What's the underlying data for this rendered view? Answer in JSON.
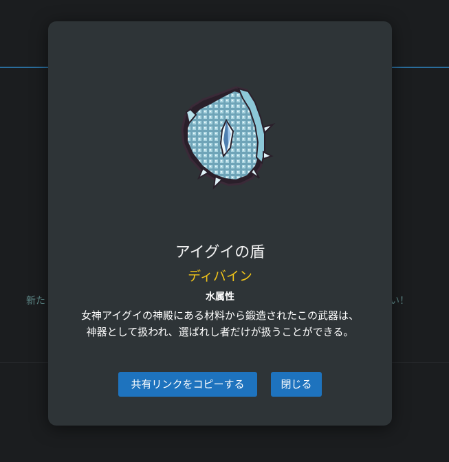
{
  "background": {
    "text_left": "新た",
    "text_right": "い！"
  },
  "modal": {
    "item_icon": "divine-shield-image",
    "item_name": "アイグイの盾",
    "rarity": "ディバイン",
    "attribute": "水属性",
    "description": "女神アイグイの神殿にある材料から鍛造されたこの武器は、神器として扱われ、選ばれし者だけが扱うことができる。",
    "share_button_label": "共有リンクをコピーする",
    "close_button_label": "閉じる"
  },
  "colors": {
    "modal_background": "#2e3437",
    "rarity_gold": "#f0c419",
    "button_blue": "#1e73be",
    "header_accent": "#2a6d9c"
  }
}
